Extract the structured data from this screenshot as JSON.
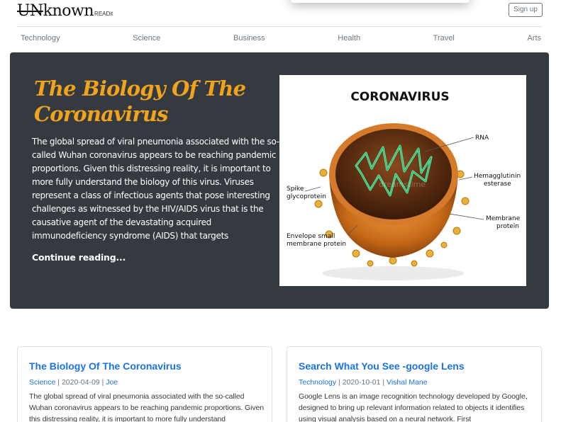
{
  "header": {
    "logo_strike": "UN",
    "logo_rest": "known",
    "logo_sub": "READit",
    "signup_label": "Sign up"
  },
  "nav": [
    "Technology",
    "Science",
    "Business",
    "Health",
    "Travel",
    "Arts"
  ],
  "hero": {
    "title": "The Biology Of The Coronavirus",
    "text": "The global spread of viral pneumonia associated with the so-called Wuhan coronavirus appears to be reaching pandemic proportions. Given this distressing reality, it is important to more fully understand the biology of this virus. Viruses represent a class of infectious agents that pose interesting challenges as witnessed by the HIV/AIDS virus that is the causative agent of the devastating acquired immunodeficiency syndrome (AIDS) that targets",
    "continue_label": "Continue reading...",
    "image": {
      "heading": "CORONAVIRUS",
      "labels": {
        "rna": "RNA",
        "hemagglutinin_1": "Hemagglutinin",
        "hemagglutinin_2": "esterase",
        "spike_1": "Spike",
        "spike_2": "glycoprotein",
        "membrane_1": "Membrane",
        "membrane_2": "protein",
        "envelope_1": "Envelope small",
        "envelope_2": "membrane protein"
      },
      "watermark": "dreamstime"
    }
  },
  "cards": [
    {
      "title": "The Biology Of The Coronavirus",
      "category": "Science",
      "date": "2020-04-09",
      "author": "Joe",
      "separator": "|",
      "excerpt": "The global spread of viral pneumonia associated with the so-called Wuhan coronavirus appears to be reaching pandemic proportions. Given this distressing reality, it is important to more fully understand"
    },
    {
      "title": "Search What You See -google Lens",
      "category": "Technology",
      "date": "2020-10-01",
      "author": "Vishal Mane",
      "separator": "|",
      "excerpt": "Google Lens is an image recognition technology developed by Google, designed to bring up relevant information related to objects it identifies using visual analysis based on a neural network. First"
    }
  ],
  "colors": {
    "accent": "#f0a31b",
    "hero_bg": "#343a40",
    "link": "#1a73e8"
  }
}
